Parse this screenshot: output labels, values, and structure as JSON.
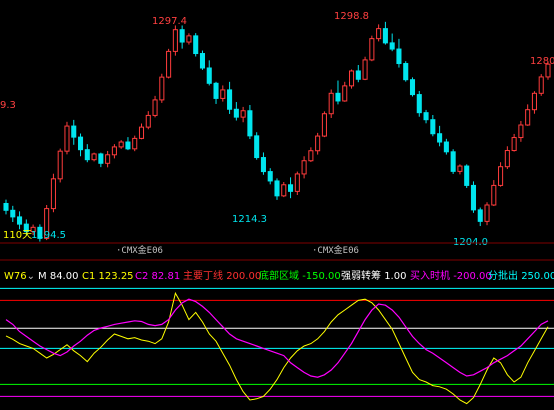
{
  "price_panel": {
    "period_label": "110天",
    "price_labels": {
      "left": "9.3",
      "high1": "1297.4",
      "low1": "1214.3",
      "high2": "1298.8",
      "low2": "1204.0",
      "right": "1280.",
      "low0": "1194.5"
    },
    "axis_markers": [
      "CMX金E06",
      "CMX金E06"
    ]
  },
  "indicator_header": {
    "name": "W76",
    "items": [
      {
        "label": "M",
        "value": "84.00",
        "color": "#ffffff"
      },
      {
        "label": "C1",
        "value": "123.25",
        "color": "#ffff00"
      },
      {
        "label": "C2",
        "value": "82.81",
        "color": "#ff00ff"
      },
      {
        "label": "主要丁线",
        "value": "200.00",
        "color": "#ff3030"
      },
      {
        "label": "底部区域",
        "value": "-150.00",
        "color": "#00ff00"
      },
      {
        "label": "强弱转筹",
        "value": "1.00",
        "color": "#ffffff"
      },
      {
        "label": "买入时机",
        "value": "-200.00",
        "color": "#ff00ff"
      },
      {
        "label": "分批出",
        "value": "250.00",
        "color": "#00ffff"
      }
    ]
  },
  "colors": {
    "background": "#000000",
    "up_candle": "#ff3c3c",
    "down_candle": "#00e5ee",
    "label_red": "#ff4040",
    "label_cyan": "#00e5ee",
    "axis_text": "#c0c0c0",
    "divider": "#800000",
    "c1_line": "#ffff00",
    "c2_line": "#ff00ff",
    "level_white": "#ffffff",
    "level_cyan": "#00ffff",
    "level_green": "#00ff00",
    "level_red": "#ff0000"
  },
  "chart_data": {
    "type": "candlestick",
    "price_ohlc": [
      [
        1212.8,
        1214.6,
        1207.7,
        1209.6
      ],
      [
        1209.6,
        1211.7,
        1204.1,
        1206.5
      ],
      [
        1206.5,
        1209.1,
        1200.7,
        1203.1
      ],
      [
        1203.1,
        1205.3,
        1197.7,
        1199.6
      ],
      [
        1199.6,
        1202.9,
        1198.0,
        1201.6
      ],
      [
        1201.6,
        1203.0,
        1194.9,
        1196.4
      ],
      [
        1196.4,
        1212.1,
        1195.6,
        1210.4
      ],
      [
        1210.4,
        1226.8,
        1208.7,
        1224.4
      ],
      [
        1224.4,
        1238.6,
        1222.7,
        1237.4
      ],
      [
        1237.4,
        1251.2,
        1235.9,
        1249.2
      ],
      [
        1249.2,
        1252.1,
        1240.4,
        1244.0
      ],
      [
        1244.0,
        1245.7,
        1235.0,
        1238.1
      ],
      [
        1238.1,
        1240.7,
        1232.2,
        1233.4
      ],
      [
        1233.4,
        1236.7,
        1232.6,
        1236.1
      ],
      [
        1236.1,
        1236.7,
        1229.9,
        1231.7
      ],
      [
        1231.7,
        1237.5,
        1229.8,
        1235.7
      ],
      [
        1235.7,
        1240.7,
        1234.0,
        1239.4
      ],
      [
        1239.4,
        1242.6,
        1238.5,
        1241.7
      ],
      [
        1241.7,
        1244.0,
        1237.9,
        1238.5
      ],
      [
        1238.5,
        1244.7,
        1237.4,
        1243.4
      ],
      [
        1243.4,
        1250.4,
        1243.0,
        1248.7
      ],
      [
        1248.7,
        1256.2,
        1247.7,
        1254.2
      ],
      [
        1254.2,
        1263.4,
        1253.3,
        1261.5
      ],
      [
        1261.5,
        1273.8,
        1260.1,
        1272.2
      ],
      [
        1272.2,
        1285.5,
        1271.6,
        1284.3
      ],
      [
        1284.3,
        1296.5,
        1282.3,
        1294.5
      ],
      [
        1294.5,
        1296.5,
        1285.6,
        1288.7
      ],
      [
        1288.7,
        1292.8,
        1287.5,
        1291.6
      ],
      [
        1291.6,
        1292.9,
        1281.9,
        1283.3
      ],
      [
        1283.3,
        1284.7,
        1275.6,
        1276.5
      ],
      [
        1276.5,
        1280.1,
        1268.3,
        1269.3
      ],
      [
        1269.3,
        1270.0,
        1259.6,
        1262.2
      ],
      [
        1262.2,
        1268.3,
        1260.7,
        1266.2
      ],
      [
        1266.2,
        1270.0,
        1254.9,
        1257.1
      ],
      [
        1257.1,
        1260.5,
        1251.8,
        1253.4
      ],
      [
        1253.4,
        1258.2,
        1251.0,
        1256.4
      ],
      [
        1256.4,
        1259.1,
        1243.1,
        1244.6
      ],
      [
        1244.6,
        1246.3,
        1233.4,
        1234.4
      ],
      [
        1234.4,
        1236.8,
        1226.3,
        1227.8
      ],
      [
        1227.8,
        1229.4,
        1221.8,
        1223.4
      ],
      [
        1223.4,
        1224.6,
        1214.5,
        1216.4
      ],
      [
        1216.4,
        1222.9,
        1215.8,
        1221.6
      ],
      [
        1221.6,
        1225.1,
        1215.3,
        1218.5
      ],
      [
        1218.5,
        1227.8,
        1216.8,
        1226.7
      ],
      [
        1226.7,
        1235.0,
        1224.6,
        1232.9
      ],
      [
        1232.9,
        1239.2,
        1232.3,
        1237.6
      ],
      [
        1237.6,
        1246.0,
        1235.8,
        1244.5
      ],
      [
        1244.5,
        1256.1,
        1244.0,
        1255.0
      ],
      [
        1255.0,
        1266.4,
        1253.0,
        1264.6
      ],
      [
        1264.6,
        1270.6,
        1259.4,
        1261.0
      ],
      [
        1261.0,
        1270.0,
        1260.6,
        1268.1
      ],
      [
        1268.1,
        1275.8,
        1266.8,
        1275.1
      ],
      [
        1275.1,
        1277.9,
        1269.8,
        1271.2
      ],
      [
        1271.2,
        1281.8,
        1270.8,
        1280.3
      ],
      [
        1280.3,
        1291.7,
        1279.7,
        1290.3
      ],
      [
        1290.3,
        1297.0,
        1289.0,
        1295.0
      ],
      [
        1295.0,
        1298.2,
        1287.5,
        1288.3
      ],
      [
        1288.3,
        1292.7,
        1284.4,
        1285.4
      ],
      [
        1285.4,
        1290.2,
        1276.7,
        1278.6
      ],
      [
        1278.6,
        1279.7,
        1270.1,
        1271.0
      ],
      [
        1271.0,
        1272.1,
        1263.1,
        1264.0
      ],
      [
        1264.0,
        1265.7,
        1253.6,
        1255.5
      ],
      [
        1255.5,
        1256.8,
        1250.5,
        1252.2
      ],
      [
        1252.2,
        1254.4,
        1244.4,
        1245.6
      ],
      [
        1245.6,
        1249.3,
        1239.7,
        1241.7
      ],
      [
        1241.7,
        1243.2,
        1235.8,
        1237.1
      ],
      [
        1237.1,
        1238.3,
        1226.7,
        1227.9
      ],
      [
        1227.9,
        1231.2,
        1226.5,
        1230.4
      ],
      [
        1230.4,
        1231.2,
        1220.1,
        1221.3
      ],
      [
        1221.3,
        1223.2,
        1208.4,
        1209.8
      ],
      [
        1209.8,
        1210.9,
        1202.2,
        1204.4
      ],
      [
        1204.4,
        1213.4,
        1202.6,
        1212.1
      ],
      [
        1212.1,
        1223.8,
        1211.6,
        1221.3
      ],
      [
        1221.3,
        1232.2,
        1220.7,
        1230.1
      ],
      [
        1230.1,
        1239.7,
        1229.0,
        1237.7
      ],
      [
        1237.7,
        1245.5,
        1237.2,
        1243.8
      ],
      [
        1243.8,
        1251.6,
        1241.8,
        1249.7
      ],
      [
        1249.7,
        1259.4,
        1249.3,
        1256.9
      ],
      [
        1256.9,
        1265.6,
        1255.0,
        1264.6
      ],
      [
        1264.6,
        1273.6,
        1263.4,
        1272.3
      ],
      [
        1272.3,
        1279.5,
        1271.0,
        1278.3
      ]
    ],
    "c1_values": [
      52,
      38,
      20,
      10,
      0,
      -20,
      -40,
      -25,
      -5,
      15,
      -10,
      -30,
      -55,
      -20,
      5,
      35,
      60,
      50,
      40,
      45,
      35,
      30,
      20,
      40,
      110,
      230,
      180,
      120,
      150,
      110,
      60,
      30,
      -20,
      -70,
      -130,
      -180,
      -215,
      -210,
      -200,
      -170,
      -130,
      -80,
      -40,
      -10,
      10,
      20,
      40,
      70,
      110,
      140,
      160,
      180,
      200,
      205,
      190,
      160,
      120,
      80,
      20,
      -40,
      -100,
      -130,
      -140,
      -155,
      -160,
      -170,
      -190,
      -215,
      -230,
      -205,
      -150,
      -90,
      -40,
      -60,
      -110,
      -140,
      -120,
      -60,
      -10,
      40,
      90
    ],
    "c2_values": [
      120,
      100,
      70,
      50,
      30,
      10,
      -5,
      -20,
      -30,
      -15,
      10,
      30,
      55,
      75,
      85,
      92,
      100,
      105,
      110,
      115,
      112,
      100,
      95,
      100,
      120,
      160,
      190,
      205,
      195,
      175,
      150,
      120,
      90,
      60,
      40,
      30,
      20,
      10,
      0,
      -10,
      -20,
      -30,
      -60,
      -80,
      -100,
      -115,
      -120,
      -110,
      -90,
      -60,
      -20,
      20,
      70,
      120,
      160,
      185,
      180,
      160,
      130,
      90,
      50,
      20,
      -5,
      -20,
      -40,
      -60,
      -80,
      -100,
      -115,
      -110,
      -95,
      -80,
      -60,
      -45,
      -30,
      -10,
      10,
      40,
      70,
      100,
      115
    ],
    "bar_values": [
      0,
      0,
      0,
      0,
      0,
      0,
      0,
      0,
      0,
      0,
      0,
      0,
      0,
      0,
      0,
      0,
      0,
      0,
      0,
      0,
      0,
      0,
      0,
      0,
      0,
      0,
      0,
      0,
      0,
      0,
      0,
      0,
      0,
      0,
      0,
      0,
      0,
      0,
      0,
      0,
      0,
      0,
      0,
      0,
      0,
      0,
      0,
      0,
      0,
      0,
      0,
      0,
      0,
      0,
      0,
      0,
      0,
      0,
      0,
      0,
      0,
      0,
      0,
      0,
      0,
      0,
      0,
      0,
      0,
      0,
      0,
      0,
      0,
      0,
      0,
      0,
      0,
      0,
      0,
      0,
      0
    ],
    "levels": [
      250,
      200,
      84,
      0,
      -150,
      -200
    ]
  }
}
